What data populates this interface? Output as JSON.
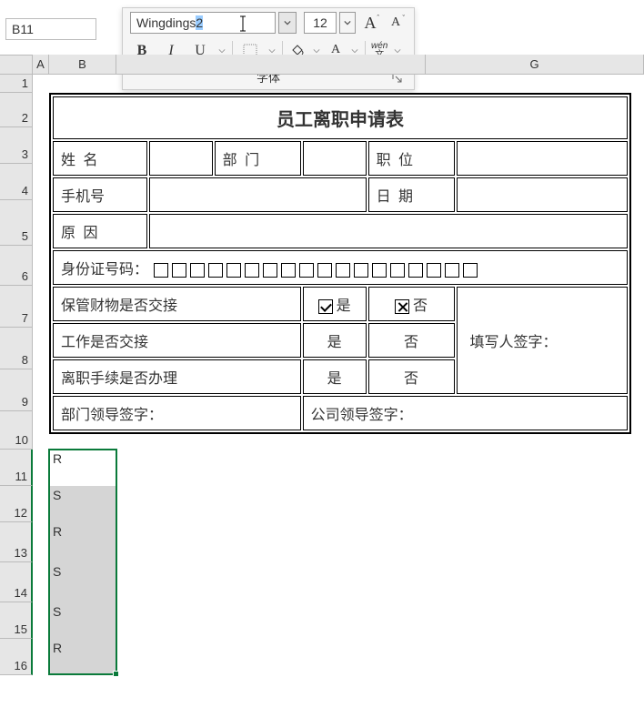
{
  "namebox": {
    "ref": "B11"
  },
  "toolbar": {
    "font_name_left": "Wingdings ",
    "font_name_sel": "2",
    "font_size": "12",
    "bold": "B",
    "italic": "I",
    "underline": "U",
    "fontcolor_glyph": "A",
    "wen_pinyin": "wén",
    "wen_char": "文",
    "group_label": "字体"
  },
  "columns": {
    "A": "A",
    "B": "B",
    "G": "G"
  },
  "rows": [
    "1",
    "2",
    "3",
    "4",
    "5",
    "6",
    "7",
    "8",
    "9",
    "10",
    "11",
    "12",
    "13",
    "14",
    "15",
    "16"
  ],
  "form": {
    "title": "员工离职申请表",
    "r3": {
      "name": "姓 名",
      "dept": "部 门",
      "pos": "职 位"
    },
    "r4": {
      "phone": "手机号",
      "date": "日 期"
    },
    "r5": {
      "reason": "原 因"
    },
    "r6": {
      "idlabel": "身份证号码：",
      "boxes": 18
    },
    "r7": {
      "q": "保管财物是否交接",
      "yes": "是",
      "no": "否"
    },
    "r8": {
      "q": "工作是否交接",
      "yes": "是",
      "no": "否",
      "filler": "填写人签字："
    },
    "r9": {
      "q": "离职手续是否办理",
      "yes": "是",
      "no": "否"
    },
    "r10": {
      "deptsign": "部门领导签字：",
      "cosign": "公司领导签字："
    }
  },
  "selection": {
    "range": "B11:B16",
    "values": [
      "R",
      "S",
      "R",
      "S",
      "S",
      "R"
    ]
  }
}
